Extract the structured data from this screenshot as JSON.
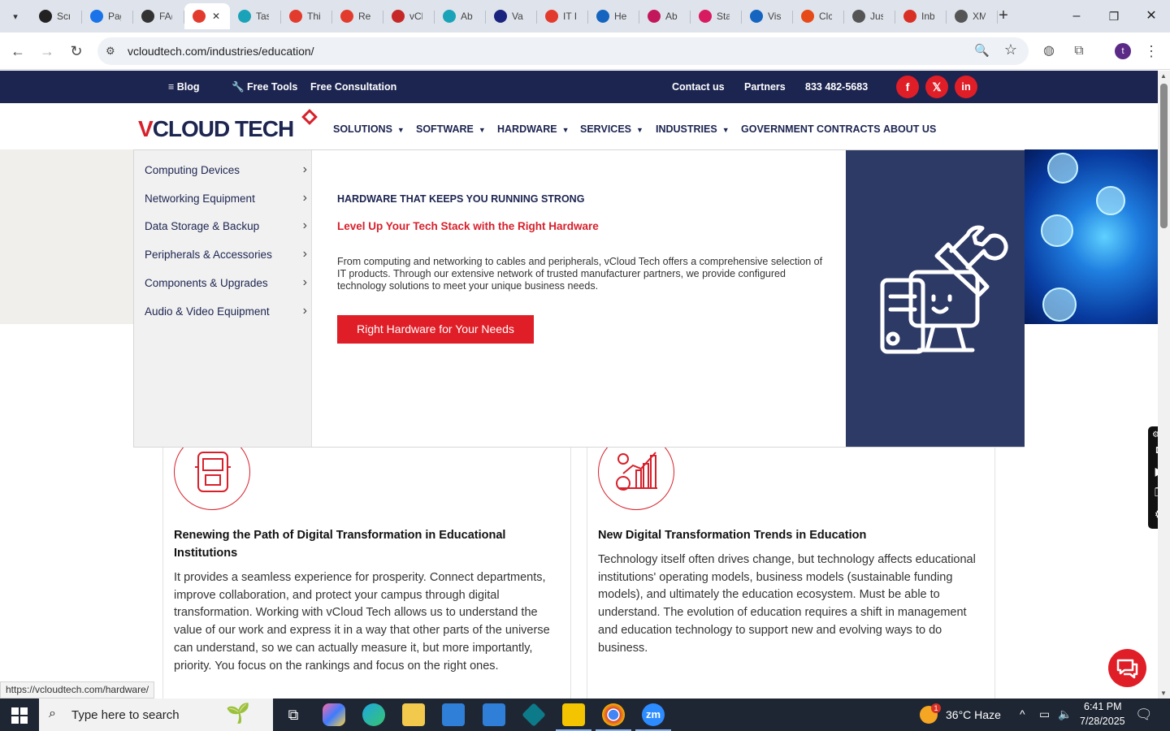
{
  "browser": {
    "tabs": [
      {
        "label": "Scr",
        "color": "#222"
      },
      {
        "label": "Pag",
        "color": "#1a73e8"
      },
      {
        "label": "FA(",
        "color": "#333"
      },
      {
        "label": "",
        "color": "#e23b2e",
        "active": true
      },
      {
        "label": "Tas",
        "color": "#1aa3b8"
      },
      {
        "label": "Thi",
        "color": "#e23b2e"
      },
      {
        "label": "Rei",
        "color": "#e23b2e"
      },
      {
        "label": "vCl",
        "color": "#c62828"
      },
      {
        "label": "Ab",
        "color": "#1aa3b8"
      },
      {
        "label": "Va",
        "color": "#1a237e"
      },
      {
        "label": "IT I",
        "color": "#e23b2e"
      },
      {
        "label": "He",
        "color": "#1565c0"
      },
      {
        "label": "Ab",
        "color": "#c2185b"
      },
      {
        "label": "Sta",
        "color": "#d81b60"
      },
      {
        "label": "Vis",
        "color": "#1565c0"
      },
      {
        "label": "Clc",
        "color": "#e64a19"
      },
      {
        "label": "Jus",
        "color": "#555"
      },
      {
        "label": "Inb",
        "color": "#d93025"
      },
      {
        "label": "XM",
        "color": "#555"
      }
    ],
    "new_tab": "+",
    "minimize": "–",
    "maximize": "❐",
    "close": "✕",
    "url": "vcloudtech.com/industries/education/",
    "profile_initial": "t",
    "status_url": "https://vcloudtech.com/hardware/"
  },
  "topbar": {
    "blog": "Blog",
    "free_tools": "Free Tools",
    "free_consultation": "Free Consultation",
    "contact_us": "Contact us",
    "partners": "Partners",
    "phone": "833 482-5683",
    "social": [
      "f",
      "𝕏",
      "in"
    ]
  },
  "nav": {
    "logo_v": "V",
    "logo_rest": "CLOUD TECH",
    "items": [
      {
        "label": "SOLUTIONS",
        "dropdown": true
      },
      {
        "label": "SOFTWARE",
        "dropdown": true
      },
      {
        "label": "HARDWARE",
        "dropdown": true
      },
      {
        "label": "SERVICES",
        "dropdown": true
      },
      {
        "label": "INDUSTRIES",
        "dropdown": true
      },
      {
        "label": "GOVERNMENT CONTRACTS",
        "dropdown": false
      },
      {
        "label": "ABOUT US",
        "dropdown": false
      }
    ]
  },
  "megamenu": {
    "categories": [
      "Computing Devices",
      "Networking Equipment",
      "Data Storage & Backup",
      "Peripherals & Accessories",
      "Components & Upgrades",
      "Audio & Video Equipment"
    ],
    "heading": "HARDWARE THAT KEEPS YOU RUNNING STRONG",
    "subheading": "Level Up Your Tech Stack with the Right Hardware",
    "description": "From computing and networking to cables and peripherals, vCloud Tech offers a comprehensive selection of IT products. Through our extensive network of trusted manufacturer partners, we provide configured technology solutions to meet your unique business needs.",
    "button": "Right Hardware for Your Needs"
  },
  "cards": [
    {
      "title": "Renewing the Path of Digital Transformation in Educational Institutions",
      "text": "It provides a seamless experience for prosperity. Connect departments, improve collaboration, and protect your campus through digital transformation. Working with vCloud Tech allows us to understand the value of our work and express it in a way that other parts of the universe can understand, so we can actually measure it, but more importantly, priority. You focus on the rankings and focus on the right ones."
    },
    {
      "title": "New Digital Transformation Trends in Education",
      "text": "Technology itself often drives change, but technology affects educational institutions' operating models, business models (sustainable funding models), and ultimately the education ecosystem. Must be able to understand. The evolution of education requires a shift in management and education technology to support new and evolving ways to do business."
    }
  ],
  "taskbar": {
    "search_placeholder": "Type here to search",
    "weather": "36°C  Haze",
    "weather_badge": "1",
    "time": "6:41 PM",
    "date": "7/28/2025"
  },
  "colors": {
    "brand_red": "#e01e27",
    "brand_navy": "#1c2450",
    "menu_image_bg": "#2e3a66"
  }
}
